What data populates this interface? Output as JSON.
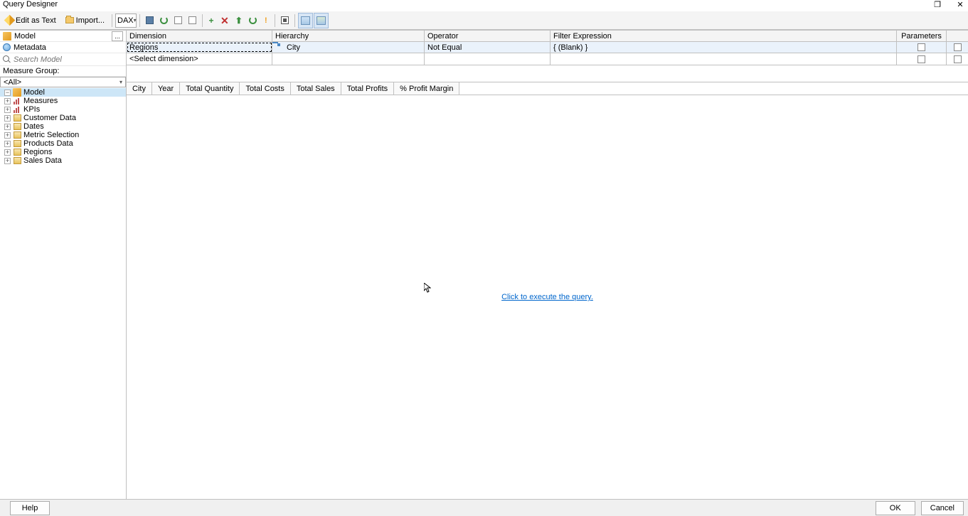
{
  "title": "Query Designer",
  "window_ctrls": {
    "restore": "❐",
    "close": "✕"
  },
  "toolbar": {
    "edit_as_text": "Edit as Text",
    "import": "Import...",
    "lang_dd": "DAX"
  },
  "sidebar": {
    "model_label": "Model",
    "model_btn": "...",
    "metadata_label": "Metadata",
    "search_placeholder": "Search Model",
    "measure_group_label": "Measure Group:",
    "measure_group_value": "<All>",
    "tree": {
      "root": "Model",
      "items": [
        {
          "label": "Measures",
          "icon": "meas"
        },
        {
          "label": "KPIs",
          "icon": "meas"
        },
        {
          "label": "Customer Data",
          "icon": "dim"
        },
        {
          "label": "Dates",
          "icon": "dim"
        },
        {
          "label": "Metric Selection",
          "icon": "dim"
        },
        {
          "label": "Products Data",
          "icon": "dim"
        },
        {
          "label": "Regions",
          "icon": "dim"
        },
        {
          "label": "Sales Data",
          "icon": "dim"
        }
      ]
    }
  },
  "filter_grid": {
    "headers": {
      "dim": "Dimension",
      "hier": "Hierarchy",
      "op": "Operator",
      "filt": "Filter Expression",
      "param": "Parameters"
    },
    "rows": [
      {
        "dim": "Regions",
        "hier": "City",
        "op": "Not Equal",
        "filt": "{ (Blank) }",
        "p1": false,
        "p2": false
      },
      {
        "dim": "<Select dimension>",
        "hier": "",
        "op": "",
        "filt": "",
        "p1": false,
        "p2": false
      }
    ]
  },
  "columns": [
    "City",
    "Year",
    "Total Quantity",
    "Total Costs",
    "Total Sales",
    "Total Profits",
    "% Profit Margin"
  ],
  "results": {
    "exec_link": "Click to execute the query."
  },
  "footer": {
    "help": "Help",
    "ok": "OK",
    "cancel": "Cancel"
  }
}
